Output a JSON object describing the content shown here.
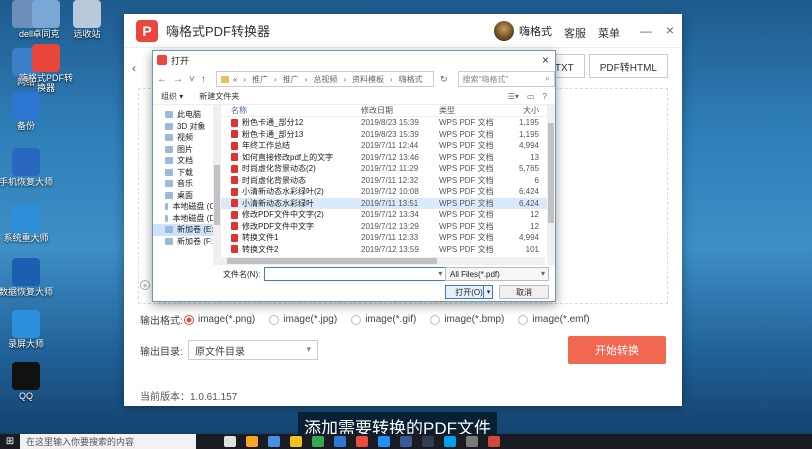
{
  "desktop": {
    "icons": [
      {
        "label": "dell",
        "color": "#6b8fb8"
      },
      {
        "label": "卓同克",
        "color": "#7aa7d6"
      },
      {
        "label": "远收站",
        "color": "#b8c9dc"
      },
      {
        "label": "网络",
        "color": "#3a7fc8"
      },
      {
        "label": "嗨格式PDF转换器",
        "color": "#e9473b"
      },
      {
        "label": "备份",
        "color": "#2c76d2"
      },
      {
        "label": "手机恢复大师",
        "color": "#2a68c0"
      },
      {
        "label": "系统重大师",
        "color": "#2d8fd8"
      },
      {
        "label": "数据恢复大师",
        "color": "#1c5fb0"
      },
      {
        "label": "录屏大师",
        "color": "#2b8fde"
      },
      {
        "label": "QQ",
        "color": "#111111"
      }
    ]
  },
  "app": {
    "title": "嗨格式PDF转换器",
    "logo_glyph": "P",
    "user_name": "嗨格式",
    "service_link": "客服",
    "menu_link": "菜单",
    "minimize_glyph": "—",
    "close_glyph": "×",
    "right_tabs": [
      "转TXT",
      "PDF转HTML"
    ],
    "output_format_label": "输出格式:",
    "formats": [
      {
        "label": "image(*.png)",
        "selected": true
      },
      {
        "label": "image(*.jpg)",
        "selected": false
      },
      {
        "label": "image(*.gif)",
        "selected": false
      },
      {
        "label": "image(*.bmp)",
        "selected": false
      },
      {
        "label": "image(*.emf)",
        "selected": false
      }
    ],
    "output_dir_label": "输出目录:",
    "output_dir_value": "原文件目录",
    "start_button": "开始转换",
    "version": "当前版本：1.0.61.157",
    "accent": "#e9473b"
  },
  "dialog": {
    "title": "打开",
    "path": [
      "«",
      "推广",
      "推广",
      "总视频",
      "资料模板",
      "嗨格式"
    ],
    "search_placeholder": "搜索\"嗨格式\"",
    "organize": "组织 ▾",
    "new_folder": "新建文件夹",
    "tree": [
      {
        "label": "此电脑",
        "sel": false
      },
      {
        "label": "3D 对象",
        "sel": false
      },
      {
        "label": "视频",
        "sel": false
      },
      {
        "label": "图片",
        "sel": false
      },
      {
        "label": "文档",
        "sel": false
      },
      {
        "label": "下载",
        "sel": false
      },
      {
        "label": "音乐",
        "sel": false
      },
      {
        "label": "桌面",
        "sel": false
      },
      {
        "label": "本地磁盘 (C:)",
        "sel": false
      },
      {
        "label": "本地磁盘 (D:)",
        "sel": false
      },
      {
        "label": "新加卷 (E:)",
        "sel": true
      },
      {
        "label": "新加卷 (F:)",
        "sel": false
      }
    ],
    "columns": [
      "名称",
      "修改日期",
      "类型",
      "大小"
    ],
    "files": [
      {
        "name": "粉色卡通_部分12",
        "date": "2019/8/23 15:39",
        "type": "WPS PDF 文档",
        "size": "1,195",
        "hl": false
      },
      {
        "name": "粉色卡通_部分13",
        "date": "2019/8/23 15:39",
        "type": "WPS PDF 文档",
        "size": "1,195",
        "hl": false
      },
      {
        "name": "年终工作总结",
        "date": "2019/7/11 12:44",
        "type": "WPS PDF 文档",
        "size": "4,994",
        "hl": false
      },
      {
        "name": "如何直接修改pdf上的文字",
        "date": "2019/7/12 13:46",
        "type": "WPS PDF 文档",
        "size": "13",
        "hl": false
      },
      {
        "name": "时尚虚化背景动态(2)",
        "date": "2019/7/12 11:29",
        "type": "WPS PDF 文档",
        "size": "5,765",
        "hl": false
      },
      {
        "name": "时尚虚化背景动态",
        "date": "2019/7/11 12:32",
        "type": "WPS PDF 文档",
        "size": "6",
        "hl": false
      },
      {
        "name": "小清新动态水彩绿叶(2)",
        "date": "2019/7/12 10:08",
        "type": "WPS PDF 文档",
        "size": "6,424",
        "hl": false
      },
      {
        "name": "小清新动态水彩绿叶",
        "date": "2019/7/11 13:51",
        "type": "WPS PDF 文档",
        "size": "6,424",
        "hl": true
      },
      {
        "name": "修改PDF文件中文字(2)",
        "date": "2019/7/12 13:34",
        "type": "WPS PDF 文档",
        "size": "12",
        "hl": false
      },
      {
        "name": "修改PDF文件中文字",
        "date": "2019/7/12 13:29",
        "type": "WPS PDF 文档",
        "size": "12",
        "hl": false
      },
      {
        "name": "转换文件1",
        "date": "2019/7/11 12:33",
        "type": "WPS PDF 文档",
        "size": "4,994",
        "hl": false
      },
      {
        "name": "转换文件2",
        "date": "2019/7/12 13:59",
        "type": "WPS PDF 文档",
        "size": "101",
        "hl": false
      }
    ],
    "filename_label": "文件名(N):",
    "filename_value": "",
    "filetype": "All Files(*.pdf)",
    "open_button": "打开(O)",
    "cancel_button": "取消"
  },
  "subtitle": "添加需要转换的PDF文件",
  "taskbar": {
    "search_placeholder": "在这里输入你要搜索的内容",
    "icon_colors": [
      "#e0e0e0",
      "#f5a623",
      "#4a90e2",
      "#f0c419",
      "#34a853",
      "#2d7ad6",
      "#e74c3c",
      "#1e90ff",
      "#3b5998",
      "#2c3e50",
      "#00a2ed",
      "#7a7a7a",
      "#d04a3b"
    ]
  }
}
